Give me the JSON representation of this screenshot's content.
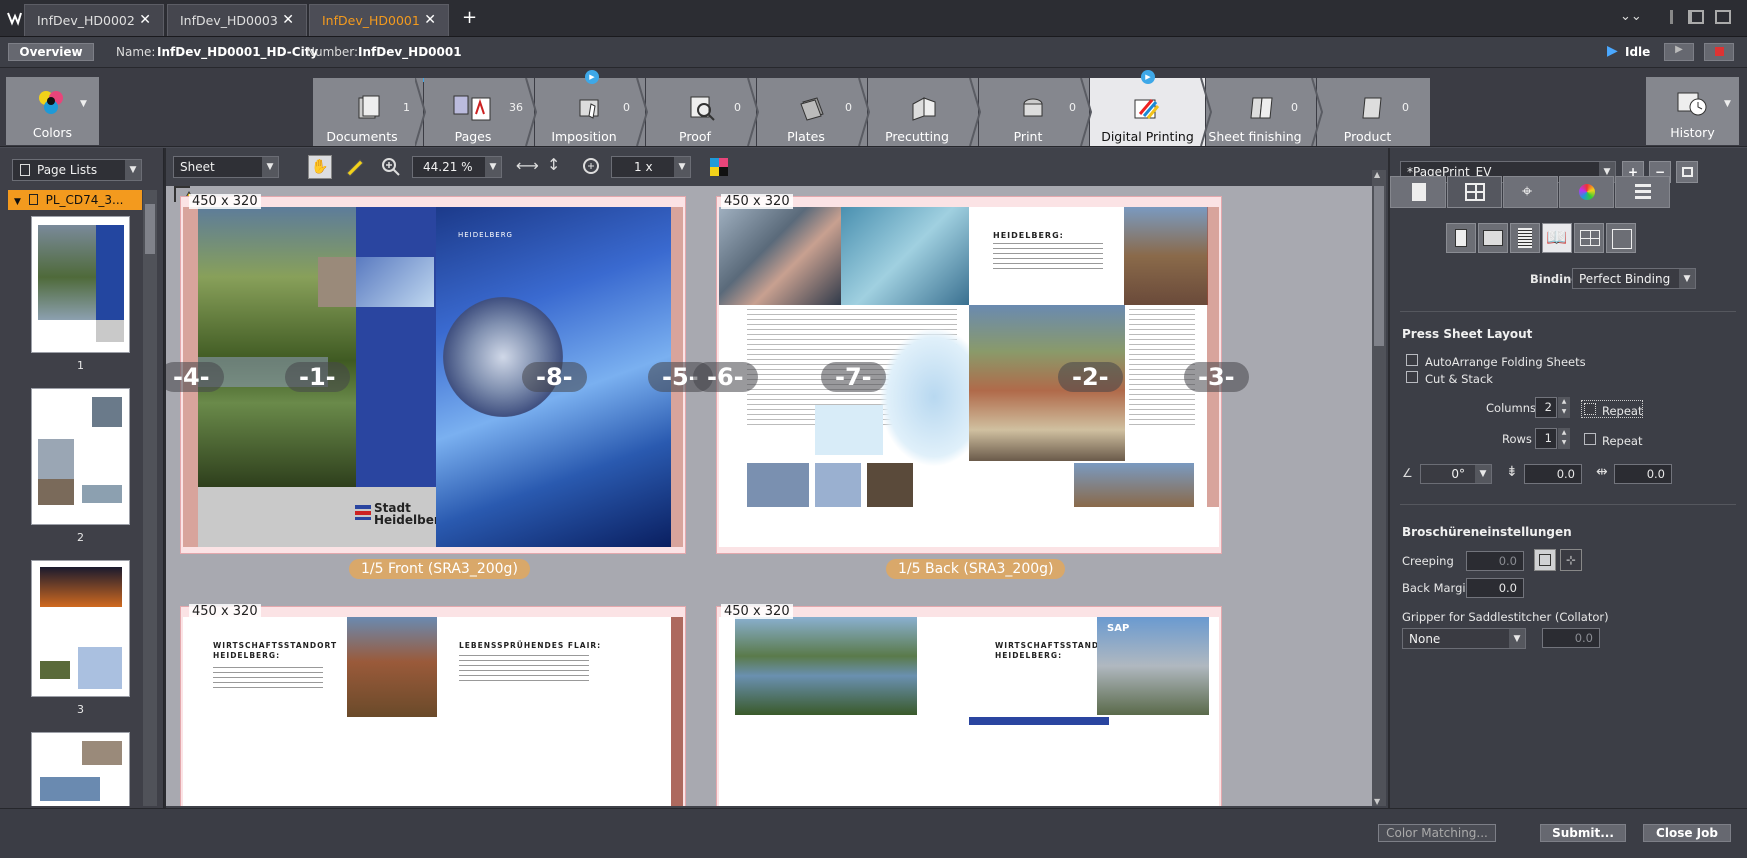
{
  "tabs": [
    {
      "label": "InfDev_HD0002",
      "active": false
    },
    {
      "label": "InfDev_HD0003",
      "active": false
    },
    {
      "label": "InfDev_HD0001",
      "active": true
    }
  ],
  "job": {
    "overview_label": "Overview",
    "name_label": "Name:",
    "name_value": "InfDev_HD0001_HD-City",
    "number_label": "Number:",
    "number_value": "InfDev_HD0001",
    "status": "Idle"
  },
  "workflow": {
    "colors_label": "Colors",
    "history_label": "History",
    "steps": [
      {
        "label": "Documents",
        "count": "1"
      },
      {
        "label": "Pages",
        "count": "36"
      },
      {
        "label": "Imposition",
        "count": "0"
      },
      {
        "label": "Proof",
        "count": "0"
      },
      {
        "label": "Plates",
        "count": "0"
      },
      {
        "label": "Precutting",
        "count": "0"
      },
      {
        "label": "Print",
        "count": "0"
      },
      {
        "label": "Digital Printing",
        "count": ""
      },
      {
        "label": "Sheet finishing",
        "count": "0"
      },
      {
        "label": "Product",
        "count": "0"
      }
    ]
  },
  "left": {
    "dropdown": "Page Lists",
    "tree_item": "PL_CD74_3...",
    "thumb_numbers": [
      "1",
      "2",
      "3"
    ]
  },
  "toolbar": {
    "view_select": "Sheet",
    "zoom": "44.21 %",
    "multiplier": "1 x"
  },
  "sheets": {
    "size": "450 x 320",
    "front_caption": "1/5 Front (SRA3_200g)",
    "back_caption": "1/5 Back (SRA3_200g)",
    "page_numbers_front": [
      "-4-",
      "-1-",
      "-8-",
      "-5-"
    ],
    "page_numbers_back": [
      "-6-",
      "-7-",
      "-2-",
      "-3-"
    ],
    "brand_text": "Stadt Heidelberg",
    "front_logo_small": "HEIDELBERG",
    "back_heading": "HEIDELBERG:",
    "lower_left_heading_1": "WIRTSCHAFTSSTANDORT HEIDELBERG:",
    "lower_left_heading_2": "LEBENSSPRÜHENDES FLAIR:",
    "lower_right_heading": "WIRTSCHAFTSSTANDORT HEIDELBERG:",
    "sap_label": "SAP"
  },
  "right": {
    "preset": "*PagePrint_EV",
    "binding_label": "Binding",
    "binding_value": "Perfect Binding",
    "press_sheet_layout": "Press Sheet Layout",
    "autoarrange": "AutoArrange Folding Sheets",
    "cut_stack": "Cut & Stack",
    "columns_label": "Columns",
    "columns_value": "2",
    "rows_label": "Rows",
    "rows_value": "1",
    "repeat_label": "Repeat",
    "angle_value": "0°",
    "offset_x": "0.0",
    "offset_y": "0.0",
    "brochure_heading": "Broschüreneinstellungen",
    "creeping_label": "Creeping",
    "creeping_value": "0.0",
    "back_margin_label": "Back Margin",
    "back_margin_value": "0.0",
    "gripper_label": "Gripper for Saddlestitcher (Collator)",
    "gripper_select": "None",
    "gripper_value": "0.0"
  },
  "footer": {
    "color_matching": "Color Matching...",
    "submit": "Submit...",
    "close_job": "Close Job"
  }
}
